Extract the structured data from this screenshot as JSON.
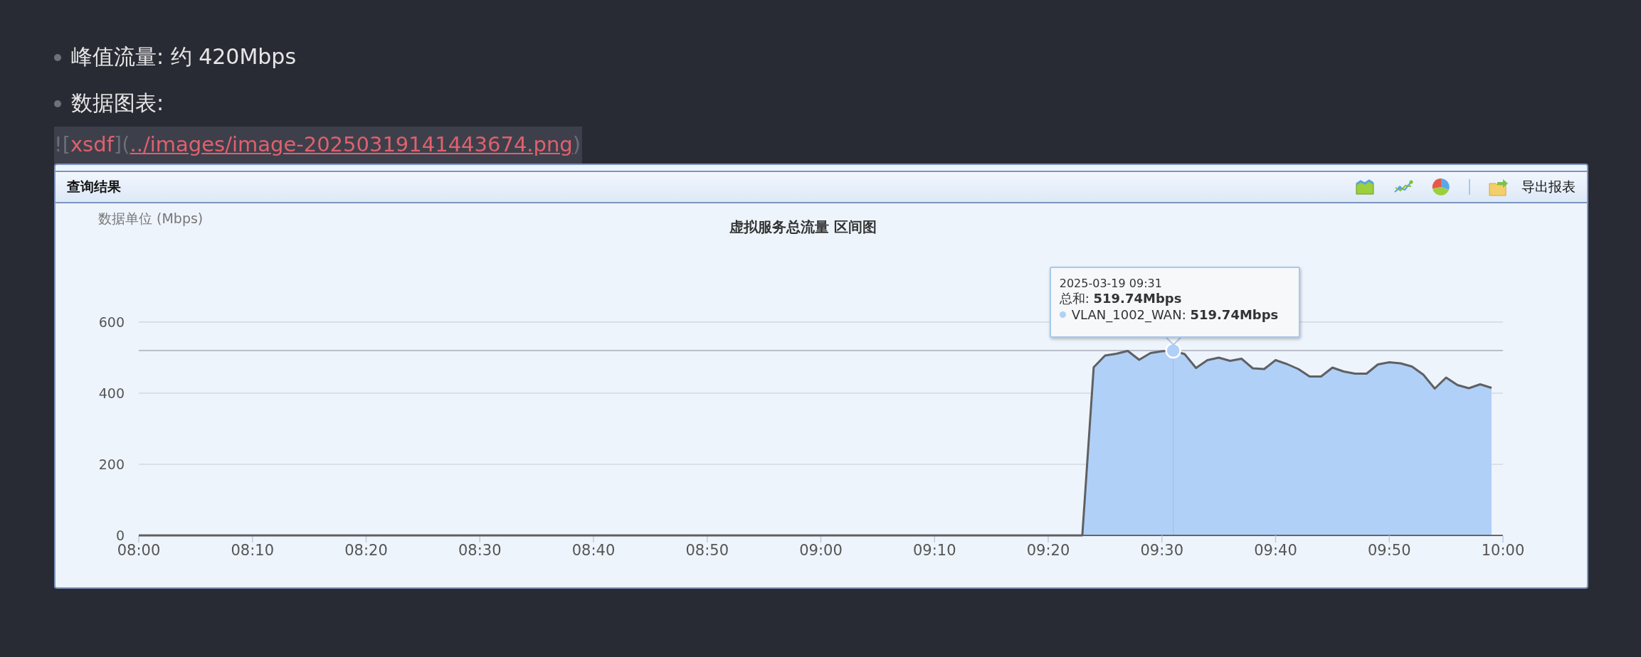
{
  "bullets": [
    {
      "text": "峰值流量: 约 420Mbps"
    },
    {
      "text": "数据图表:"
    }
  ],
  "image_markup": {
    "open": "![",
    "alt": "xsdf",
    "mid": "](",
    "src": "../images/image-20250319141443674.png",
    "close": ")"
  },
  "panel": {
    "title": "查询结果",
    "toolbar": [
      {
        "kind": "area"
      },
      {
        "kind": "line"
      },
      {
        "kind": "pie"
      },
      {
        "kind": "separator"
      },
      {
        "kind": "export",
        "label": "导出报表"
      }
    ],
    "chart_data": {
      "type": "area",
      "title": "虚拟服务总流量 区间图",
      "categories": [
        "08:00",
        null,
        null,
        null,
        null,
        null,
        null,
        null,
        null,
        null,
        "08:10",
        null,
        null,
        null,
        null,
        null,
        null,
        null,
        null,
        null,
        "08:20",
        null,
        null,
        null,
        null,
        null,
        null,
        null,
        null,
        null,
        "08:30",
        null,
        null,
        null,
        null,
        null,
        null,
        null,
        null,
        null,
        "08:40",
        null,
        null,
        null,
        null,
        null,
        null,
        null,
        null,
        null,
        "08:50",
        null,
        null,
        null,
        null,
        null,
        null,
        null,
        null,
        null,
        "09:00",
        null,
        null,
        null,
        null,
        null,
        null,
        null,
        null,
        null,
        "09:10",
        null,
        null,
        null,
        null,
        null,
        null,
        null,
        null,
        null,
        "09:20",
        null,
        null,
        null,
        null,
        null,
        null,
        null,
        null,
        null,
        "09:30",
        null,
        null,
        null,
        null,
        null,
        null,
        null,
        null,
        null,
        "09:40",
        null,
        null,
        null,
        null,
        null,
        null,
        null,
        null,
        null,
        "09:50",
        null,
        null,
        null,
        null,
        null,
        null,
        null,
        null,
        null,
        "10:00"
      ],
      "series": [
        {
          "name": "VLAN_1002_WAN",
          "color": "#b0d0f7",
          "values": [
            0,
            0,
            0,
            0,
            0,
            0,
            0,
            0,
            0,
            0,
            0,
            0,
            0,
            0,
            0,
            0,
            0,
            0,
            0,
            0,
            0,
            0,
            0,
            0,
            0,
            0,
            0,
            0,
            0,
            0,
            0,
            0,
            0,
            0,
            0,
            0,
            0,
            0,
            0,
            0,
            0,
            0,
            0,
            0,
            0,
            0,
            0,
            0,
            0,
            0,
            0,
            0,
            0,
            0,
            0,
            0,
            0,
            0,
            0,
            0,
            0,
            0,
            0,
            0,
            0,
            0,
            0,
            0,
            0,
            0,
            0,
            0,
            0,
            0,
            0,
            0,
            0,
            0,
            0,
            0,
            0,
            0,
            0,
            0,
            473,
            506,
            511,
            519,
            494,
            513,
            518,
            520,
            510,
            471,
            493,
            500,
            491,
            497,
            470,
            468,
            493,
            482,
            468,
            447,
            447,
            472,
            461,
            455,
            455,
            481,
            487,
            484,
            475,
            452,
            413,
            444,
            423,
            414,
            425,
            415,
            null
          ]
        }
      ],
      "ylim": [
        0,
        600
      ],
      "yticks": [
        0,
        200,
        400,
        600
      ],
      "grid": true,
      "ref_lines": [
        {
          "axis": "y",
          "value": 520
        }
      ],
      "annotations": [
        {
          "text": "数据单位 (Mbps)"
        }
      ]
    },
    "tooltip": {
      "time": "2025-03-19 09:31",
      "total": "总和: **519.74Mbps**",
      "series_value": ": **519.74Mbps**"
    }
  }
}
